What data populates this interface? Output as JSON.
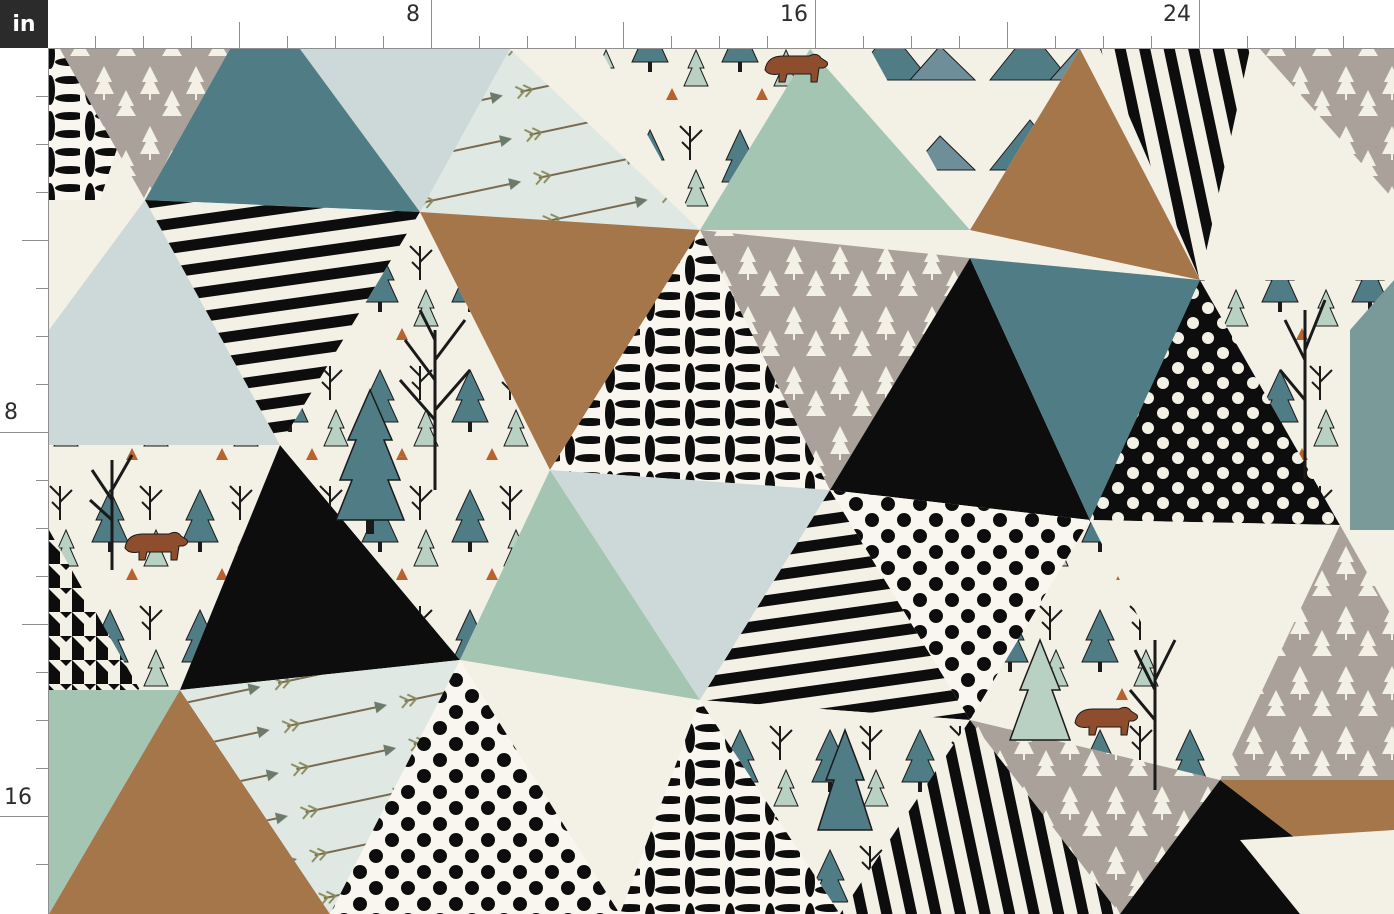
{
  "ruler": {
    "unit": "in",
    "top_labels": [
      "8",
      "16",
      "24"
    ],
    "left_labels": [
      "8",
      "16"
    ]
  },
  "palette": {
    "teal": "#4f7c85",
    "mint": "#a5c5b3",
    "sky": "#ccd9d8",
    "taupe": "#aaa29a",
    "cream": "#f3f0e6",
    "brown": "#a5764a",
    "black": "#0d0d0d",
    "bear": "#8e4e2e"
  },
  "icons": [
    "bear-icon",
    "pine-tree-icon",
    "bare-tree-icon",
    "arrow-icon",
    "mountain-icon",
    "polka-dot-pattern",
    "stripe-pattern"
  ]
}
